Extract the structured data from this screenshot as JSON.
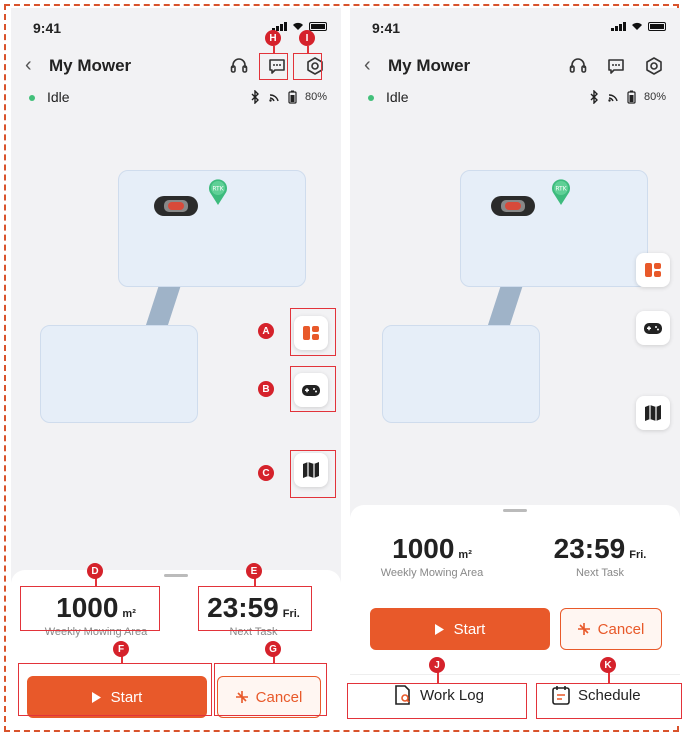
{
  "status_bar": {
    "time": "9:41"
  },
  "header": {
    "title": "My Mower",
    "back": "‹"
  },
  "device": {
    "state": "Idle",
    "battery": "80%"
  },
  "map": {
    "rtk_label": "RTK"
  },
  "stats": {
    "area_value": "1000",
    "area_unit": "m²",
    "area_caption": "Weekly Mowing Area",
    "time_value": "23:59",
    "time_day": "Fri.",
    "time_caption": "Next Task"
  },
  "actions": {
    "start": "Start",
    "cancel": "Cancel"
  },
  "tabs": {
    "work_log": "Work Log",
    "schedule": "Schedule"
  },
  "annotations": [
    "A",
    "B",
    "C",
    "D",
    "E",
    "F",
    "G",
    "H",
    "I",
    "J",
    "K"
  ],
  "colors": {
    "accent": "#e8592a",
    "annotation": "#e2333a",
    "idle": "#42c07a",
    "zone": "#e6eef8"
  },
  "icons": [
    "back-icon",
    "headset-icon",
    "message-icon",
    "settings-icon",
    "bluetooth-icon",
    "wifi-icon",
    "battery-icon",
    "mower-icon",
    "rtk-pin-icon",
    "layout-icon",
    "gamepad-icon",
    "map-icon",
    "play-icon",
    "fan-icon",
    "document-search-icon",
    "calendar-icon"
  ]
}
